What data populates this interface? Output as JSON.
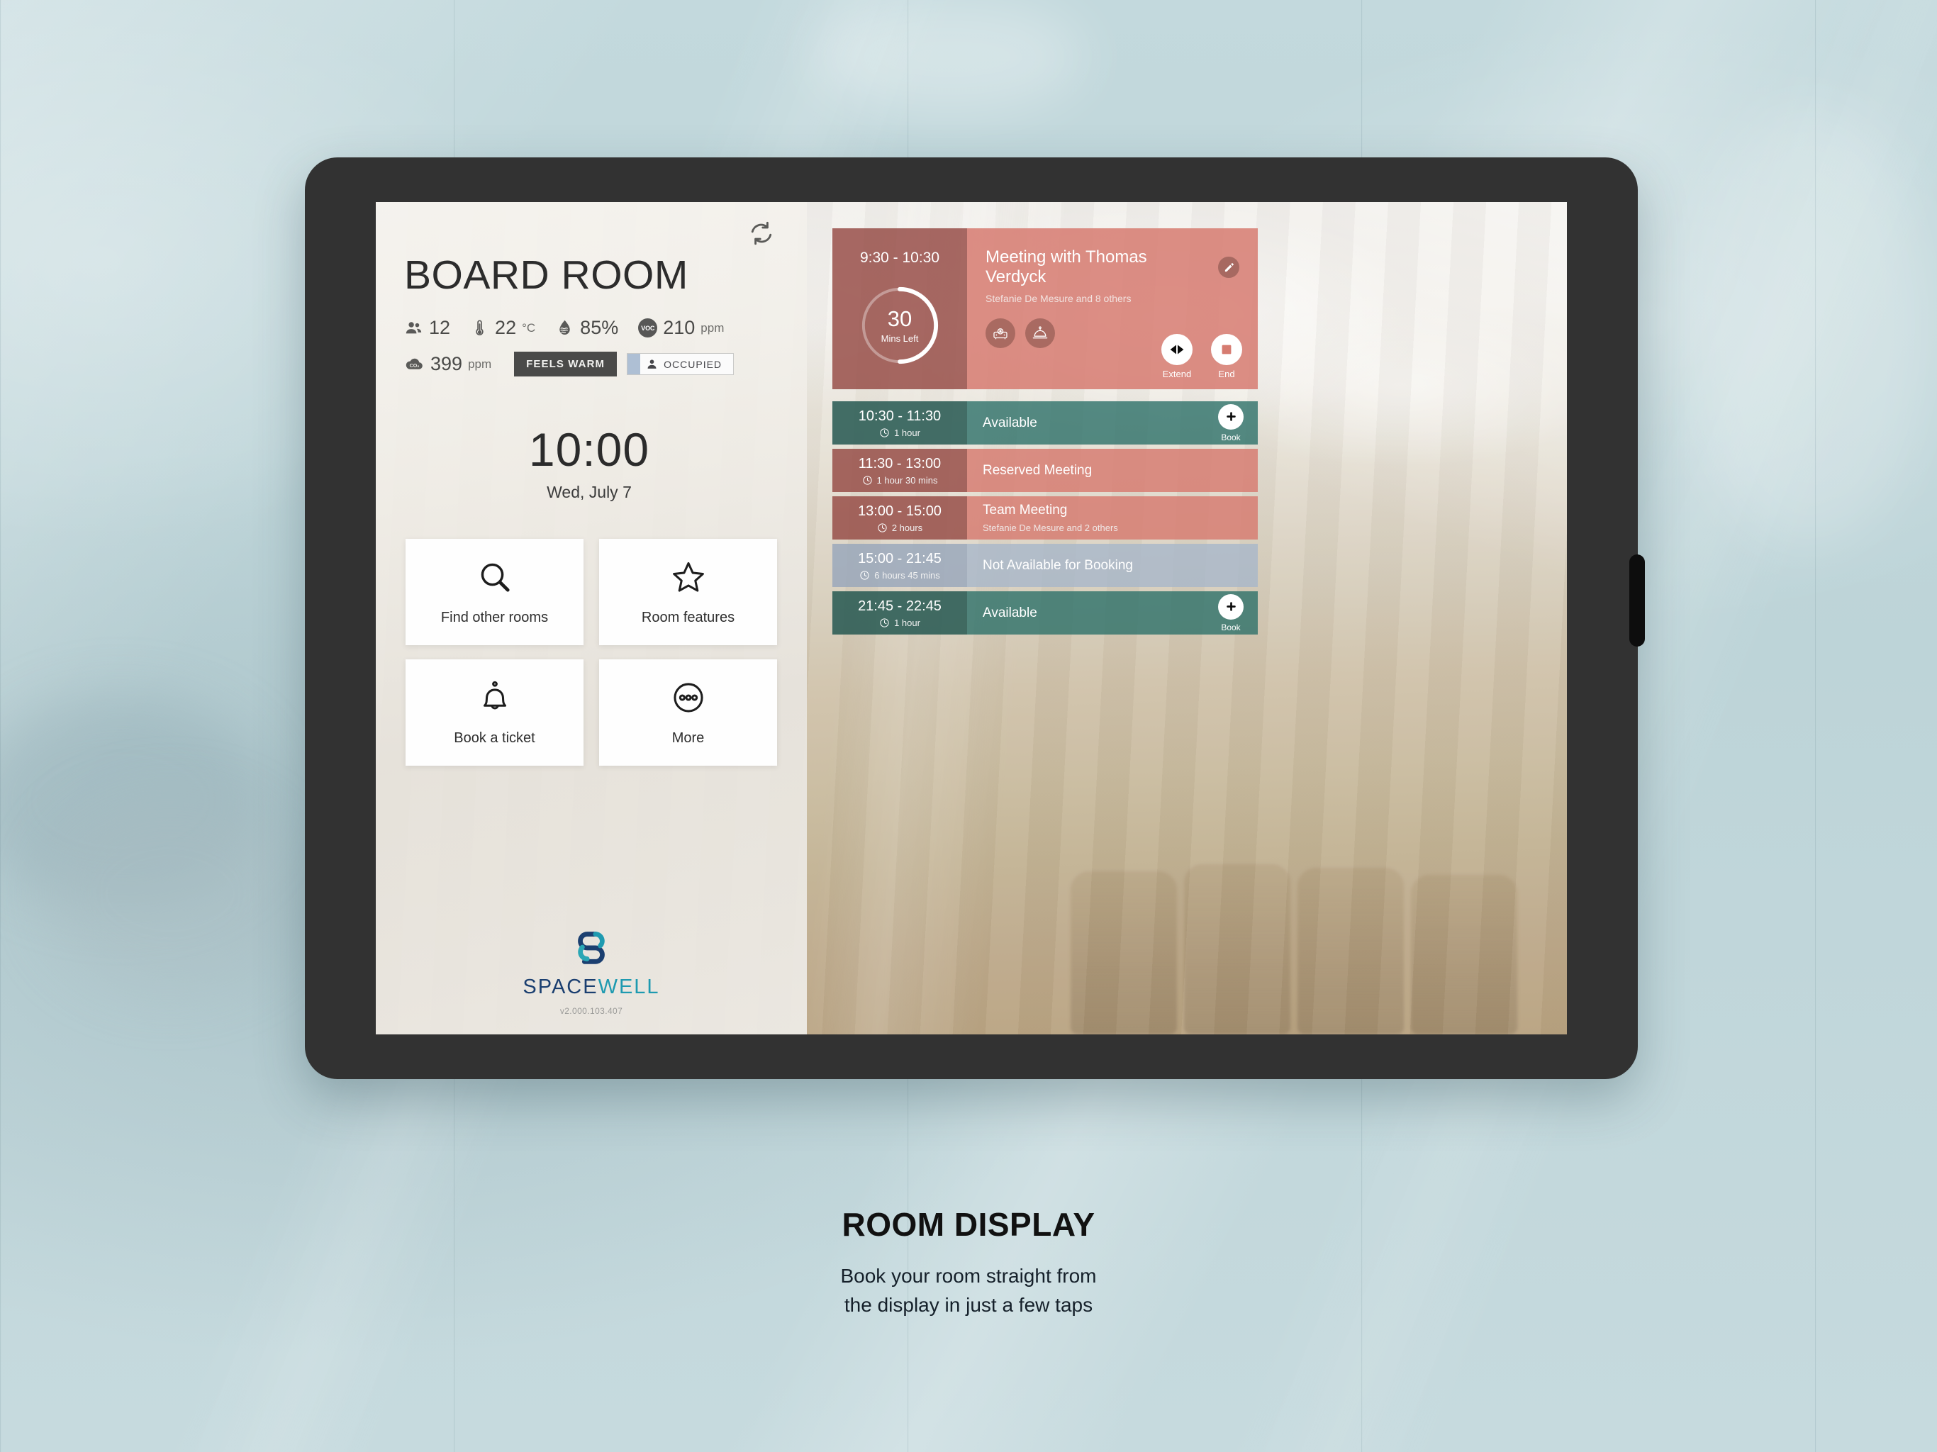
{
  "room": {
    "name": "BOARD ROOM",
    "refresh_icon": "refresh-icon",
    "sensors": [
      {
        "icon": "people-icon",
        "value": "12",
        "unit": ""
      },
      {
        "icon": "thermometer-icon",
        "value": "22",
        "unit": "°C"
      },
      {
        "icon": "humidity-icon",
        "value": "85%",
        "unit": ""
      },
      {
        "icon": "voc-icon",
        "value": "210",
        "unit": "ppm"
      }
    ],
    "co2": {
      "icon": "co2-icon",
      "value": "399",
      "unit": "ppm"
    },
    "comfort_chip": "FEELS WARM",
    "occupancy_chip": "OCCUPIED",
    "occupancy_icon": "person-icon",
    "occupancy_accent": "#aebfd4"
  },
  "clock": {
    "time": "10:00",
    "date": "Wed, July 7"
  },
  "tiles": [
    {
      "icon": "search-icon",
      "label": "Find other rooms"
    },
    {
      "icon": "star-icon",
      "label": "Room features"
    },
    {
      "icon": "bell-icon",
      "label": "Book a ticket"
    },
    {
      "icon": "ellipsis-circle-icon",
      "label": "More"
    }
  ],
  "brand": {
    "name_part_1": "SPACE",
    "name_part_2": "WELL",
    "version": "v2.000.103.407",
    "color_dark": "#1b3f70",
    "color_teal": "#1e9ab0"
  },
  "current_meeting": {
    "range": "9:30 - 10:30",
    "minutes_left": "30",
    "minutes_left_label": "Mins Left",
    "progress_percent": 50,
    "title": "Meeting with Thomas Verdyck",
    "organizer": "Stefanie De Mesure and 8 others",
    "edit_icon": "pencil-icon",
    "services": [
      {
        "icon": "projector-icon"
      },
      {
        "icon": "service-bell-icon"
      }
    ],
    "actions": [
      {
        "icon": "extend-icon",
        "label": "Extend"
      },
      {
        "icon": "stop-icon",
        "label": "End"
      }
    ]
  },
  "schedule": [
    {
      "range": "10:30 - 11:30",
      "duration": "1 hour",
      "subject": "Available",
      "organizer": "",
      "state": "available",
      "book_label": "Book",
      "book_icon": "plus-icon"
    },
    {
      "range": "11:30 - 13:00",
      "duration": "1 hour 30 mins",
      "subject": "Reserved Meeting",
      "organizer": "",
      "state": "busy",
      "book_label": "",
      "book_icon": ""
    },
    {
      "range": "13:00 - 15:00",
      "duration": "2 hours",
      "subject": "Team Meeting",
      "organizer": "Stefanie De Mesure and 2 others",
      "state": "busy",
      "book_label": "",
      "book_icon": ""
    },
    {
      "range": "15:00 - 21:45",
      "duration": "6 hours 45 mins",
      "subject": "Not Available for Booking",
      "organizer": "",
      "state": "blocked",
      "book_label": "",
      "book_icon": ""
    },
    {
      "range": "21:45 - 22:45",
      "duration": "1 hour",
      "subject": "Available",
      "organizer": "",
      "state": "available",
      "book_label": "Book",
      "book_icon": "plus-icon"
    }
  ],
  "caption": {
    "title": "ROOM DISPLAY",
    "subtitle_line_1": "Book your room straight from",
    "subtitle_line_2": "the display in just a few taps"
  },
  "palette": {
    "busy": "#d67c71",
    "busy_dark": "#964c46",
    "available": "#2d7169",
    "available_dark": "#265852",
    "blocked": "#a8b6c9",
    "page_bg": "#bfd6da"
  }
}
